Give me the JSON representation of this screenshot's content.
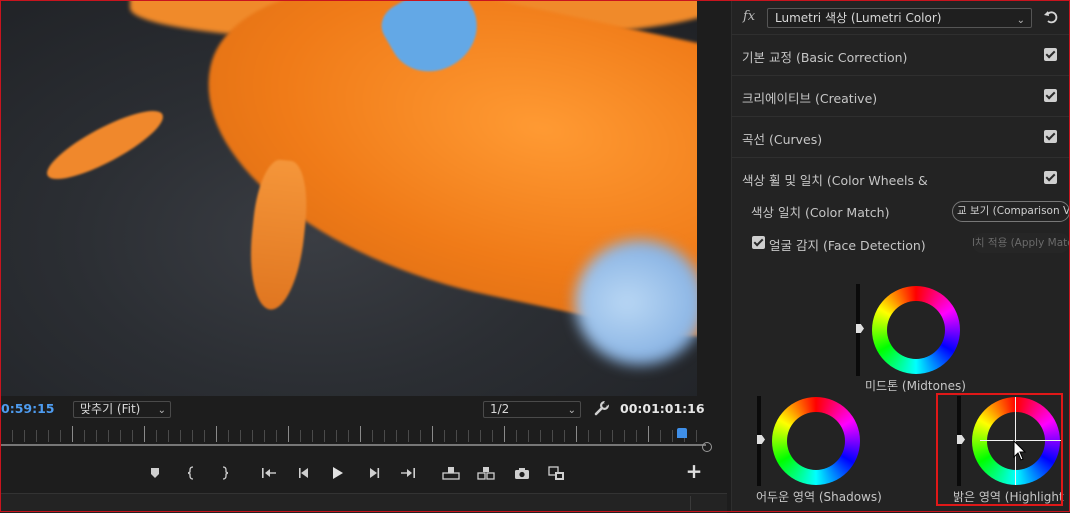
{
  "monitor": {
    "timecode_current": "0:59:15",
    "zoom_select": "맞추기 (Fit)",
    "resolution_select": "1/2",
    "timecode_duration": "00:01:01:16"
  },
  "transport": {
    "buttons": [
      "marker-icon",
      "mark-in-icon",
      "mark-out-icon",
      "go-to-in-icon",
      "step-back-icon",
      "play-icon",
      "step-forward-icon",
      "go-to-out-icon",
      "lift-icon",
      "extract-icon",
      "export-frame-icon",
      "comparison-view-icon",
      "add-button-icon"
    ]
  },
  "lumetri": {
    "fx_label": "fx",
    "effect_name": "Lumetri 색상 (Lumetri Color)",
    "sections": [
      {
        "label": "기본 교정 (Basic Correction)",
        "checked": true
      },
      {
        "label": "크리에이티브 (Creative)",
        "checked": true
      },
      {
        "label": "곡선 (Curves)",
        "checked": true
      },
      {
        "label": "색상 휠 및 일치 (Color Wheels &",
        "checked": true
      }
    ],
    "color_match_label": "색상 일치 (Color Match)",
    "comparison_button": "교 보기 (Comparison Vie",
    "face_detection_label": "얼굴 감지 (Face Detection)",
    "face_detection_checked": true,
    "apply_match_button": "l치 적용 (Apply Matc",
    "wheels": {
      "midtones": "미드톤 (Midtones)",
      "shadows": "어두운 영역 (Shadows)",
      "highlights": "밝은 영역 (Highlight"
    }
  }
}
